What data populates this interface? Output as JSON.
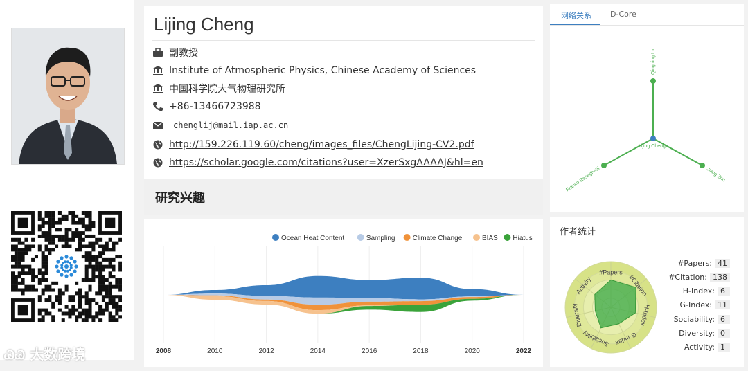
{
  "profile": {
    "name": "Lijing Cheng",
    "title": "副教授",
    "affiliation_en": "Institute of Atmospheric Physics, Chinese Academy of Sciences",
    "affiliation_zh": "中国科学院大气物理研究所",
    "phone": "+86-13466723988",
    "email": "chenglij@mail.iap.ac.cn",
    "homepage": "http://159.226.119.60/cheng/images_files/ChengLijing-CV2.pdf",
    "scholar": "https://scholar.google.com/citations?user=XzerSxgAAAAJ&hl=en"
  },
  "interests": {
    "title": "研究兴趣"
  },
  "watermark": "大数跨境",
  "chart_data": {
    "type": "area",
    "x": [
      2008,
      2010,
      2012,
      2014,
      2016,
      2018,
      2020,
      2022
    ],
    "x_tick_labels": [
      "2008",
      "2010",
      "2012",
      "2014",
      "2016",
      "2018",
      "2020",
      "2022"
    ],
    "series": [
      {
        "name": "Ocean Heat Content",
        "color": "#3d7fc0",
        "values": [
          0,
          1,
          3,
          6,
          5,
          6,
          2,
          0
        ]
      },
      {
        "name": "Sampling",
        "color": "#b7cbe6",
        "values": [
          0,
          0.5,
          1,
          2,
          1,
          0.5,
          0.2,
          0
        ]
      },
      {
        "name": "Climate Change",
        "color": "#f0923a",
        "values": [
          0,
          0.2,
          0.4,
          1.5,
          1,
          1,
          0.5,
          0
        ]
      },
      {
        "name": "BIAS",
        "color": "#f6c28e",
        "values": [
          0,
          1,
          1,
          1,
          0.2,
          0,
          0,
          0
        ]
      },
      {
        "name": "Hiatus",
        "color": "#3aa33a",
        "values": [
          0,
          0,
          0,
          0,
          1,
          2,
          0.5,
          0
        ]
      }
    ]
  },
  "network": {
    "tabs": [
      "网络关系",
      "D-Core"
    ],
    "active_tab": 0,
    "center": "Lijing Cheng",
    "nodes": [
      "Qingping Liu",
      "Franco Reseghetti",
      "Jiang Zhu"
    ],
    "node_color": "#4caf50",
    "center_color": "#3d7fc0"
  },
  "stats": {
    "title": "作者统计",
    "rows": [
      {
        "label": "#Papers:",
        "value": "41"
      },
      {
        "label": "#Citation:",
        "value": "138"
      },
      {
        "label": "H-Index:",
        "value": "6"
      },
      {
        "label": "G-Index:",
        "value": "11"
      },
      {
        "label": "Sociability:",
        "value": "6"
      },
      {
        "label": "Diversity:",
        "value": "0"
      },
      {
        "label": "Activity:",
        "value": "1"
      }
    ],
    "radar_labels": [
      "#Papers",
      "#Citation",
      "H-Index",
      "G-Index",
      "Sociability",
      "Diversity",
      "Activity"
    ],
    "radar_values": [
      0.6,
      0.7,
      0.55,
      0.4,
      0.5,
      0.35,
      0.45
    ]
  }
}
